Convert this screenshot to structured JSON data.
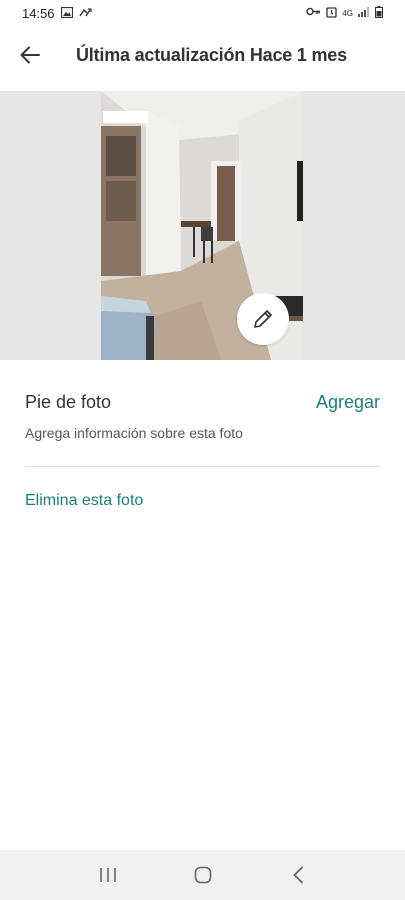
{
  "status_bar": {
    "time": "14:56",
    "network": "4G"
  },
  "header": {
    "title": "Última actualización Hace 1 mes",
    "back_icon": "arrow-left-icon"
  },
  "photo": {
    "edit_icon": "pencil-icon"
  },
  "caption": {
    "title": "Pie de foto",
    "action": "Agregar",
    "hint": "Agrega información sobre esta foto"
  },
  "delete": {
    "label": "Elimina esta foto"
  },
  "colors": {
    "accent": "#1a8078",
    "photo_background": "#e6e6e6",
    "nav_background": "#f1f1f1"
  },
  "nav": {
    "recents_icon": "recents-icon",
    "home_icon": "home-icon",
    "back_icon": "chevron-left-icon"
  }
}
